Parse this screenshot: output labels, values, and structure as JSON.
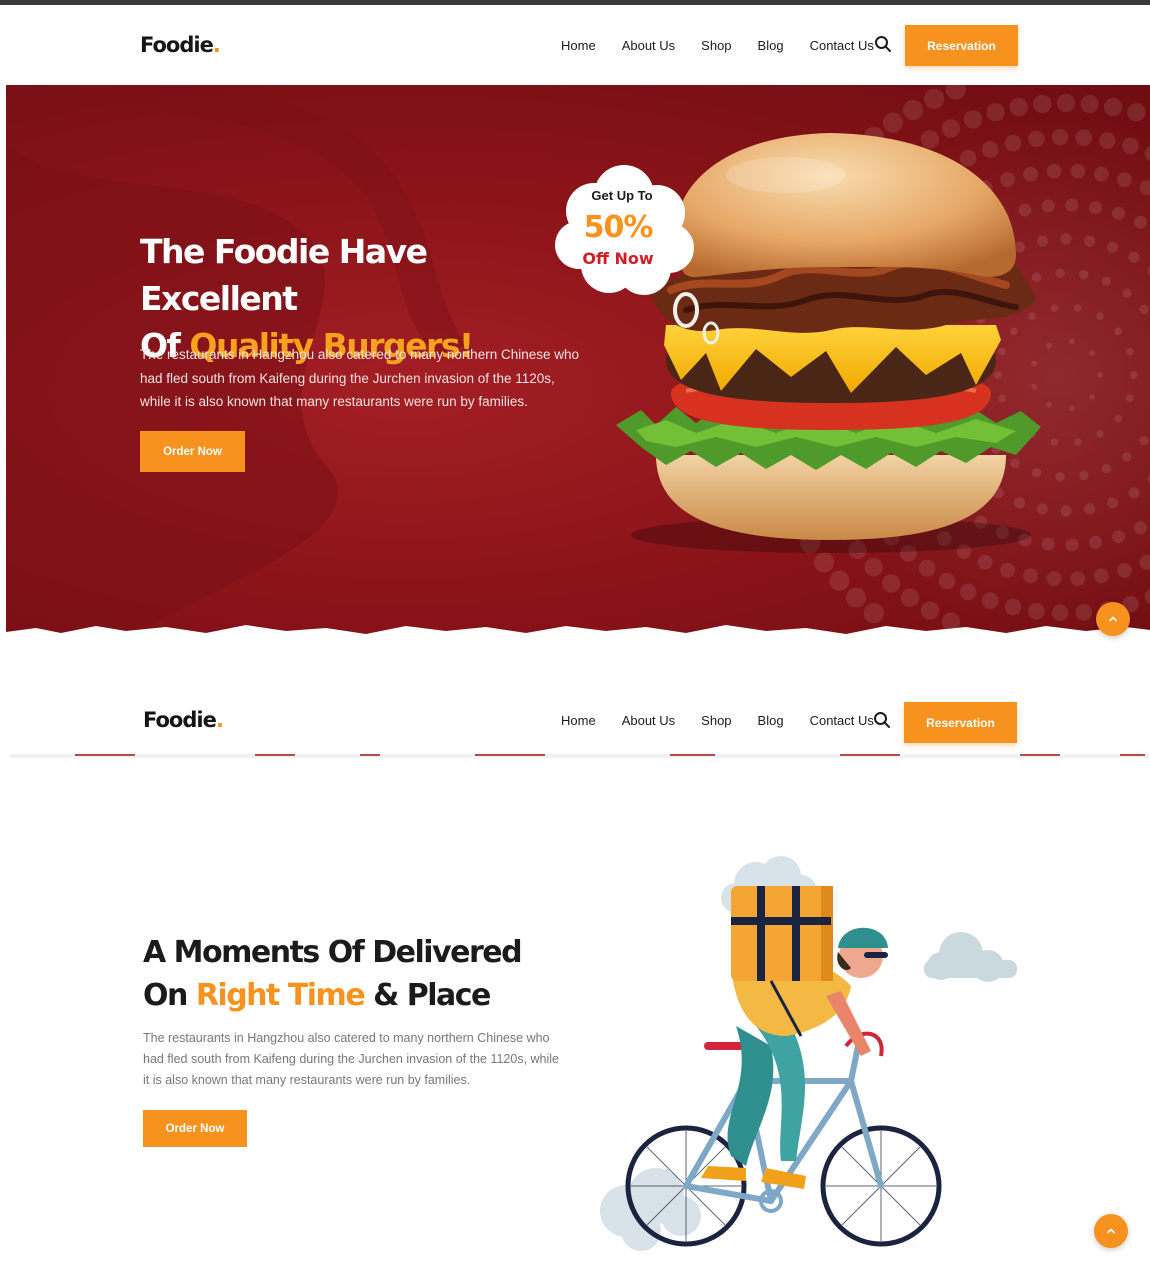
{
  "brand": {
    "name": "Foodie",
    "dot": "."
  },
  "nav": {
    "items": [
      "Home",
      "About Us",
      "Shop",
      "Blog",
      "Contact Us"
    ],
    "reservation_label": "Reservation"
  },
  "hero": {
    "title_line1": "The Foodie Have Excellent",
    "title_line2_prefix": "Of ",
    "title_line2_accent": "Quality Burgers!",
    "text": "The restaurants in Hangzhou also catered to many northern Chinese who had fled south from Kaifeng during the Jurchen invasion of the 1120s, while it is also known that many restaurants were run by families.",
    "button_label": "Order Now",
    "promo": {
      "top": "Get Up To",
      "value": "50%",
      "bottom": "Off Now"
    }
  },
  "section2": {
    "title_line1": "A Moments Of Delivered",
    "title_line2_prefix": "On ",
    "title_line2_accent": "Right Time",
    "title_line2_suffix": " & Place",
    "text": "The restaurants in Hangzhou also catered to many northern Chinese who had fled south from Kaifeng during the Jurchen invasion of the 1120s, while it is also known that many restaurants were run by families.",
    "button_label": "Order Now"
  },
  "scroll_top_icon": "chevron-up-icon",
  "colors": {
    "accent": "#f7921e",
    "hero_red": "#8c1419",
    "promo_red": "#d31d25"
  }
}
